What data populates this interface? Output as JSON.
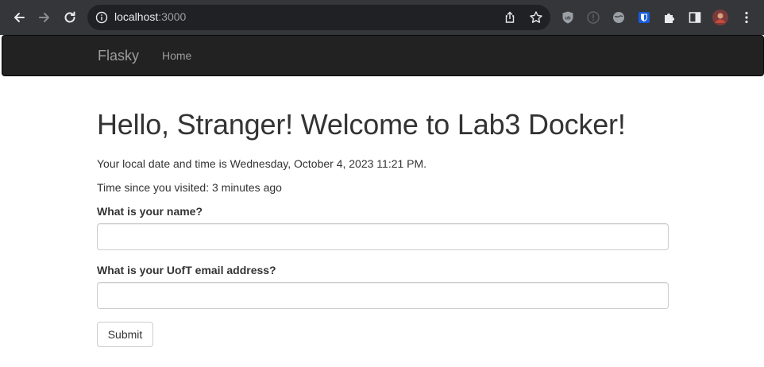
{
  "browser": {
    "url_host": "localhost",
    "url_port": ":3000",
    "icons": {
      "back": "arrow-left-icon",
      "forward": "arrow-right-icon",
      "reload": "reload-icon",
      "info": "info-icon",
      "share": "share-icon",
      "bookmark": "star-icon",
      "ublock": "ublock-origin-icon",
      "ext_info": "info-circle-icon",
      "ext_globe": "globe-icon",
      "ext_bitwarden": "bitwarden-icon",
      "extensions": "puzzle-icon",
      "side_panel": "side-panel-icon",
      "profile": "profile-avatar",
      "menu": "kebab-menu-icon"
    },
    "colors": {
      "chrome_bg": "#35363a",
      "omnibox_bg": "#202124"
    }
  },
  "navbar": {
    "brand": "Flasky",
    "links": [
      {
        "label": "Home"
      }
    ],
    "colors": {
      "bg": "#222222",
      "link": "#9d9d9d"
    }
  },
  "main": {
    "heading": "Hello, Stranger! Welcome to Lab3 Docker!",
    "datetime_line": "Your local date and time is Wednesday, October 4, 2023 11:21 PM.",
    "visited_line": "Time since you visited: 3 minutes ago",
    "form": {
      "name_label": "What is your name?",
      "name_value": "",
      "email_label": "What is your UofT email address?",
      "email_value": "",
      "submit_label": "Submit"
    }
  }
}
